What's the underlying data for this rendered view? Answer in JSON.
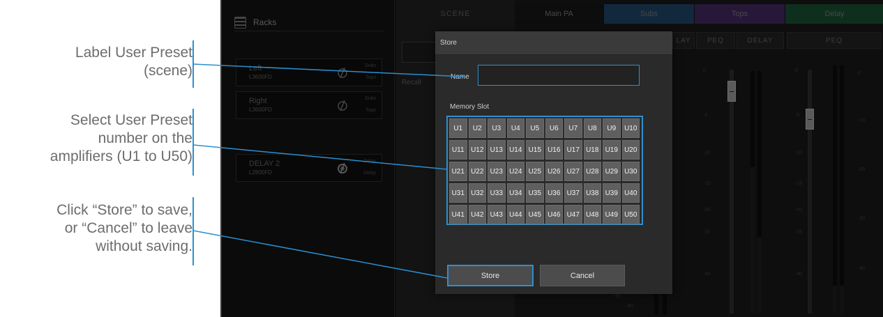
{
  "annotations": [
    {
      "lines": [
        "Label User Preset",
        "(scene)"
      ]
    },
    {
      "lines": [
        "Select User Preset",
        "number on the",
        "amplifiers (U1 to U50)"
      ]
    },
    {
      "lines": [
        "Click “Store” to save,",
        "or “Cancel” to leave",
        "without saving."
      ]
    }
  ],
  "colors": {
    "accent": "#2f8fcf",
    "subs": "#1d3f5e",
    "tops": "#3c2559",
    "delay": "#17492f",
    "main_pa": "#141414"
  },
  "racks": {
    "title": "Racks",
    "icon": "rack-list-icon",
    "items": [
      {
        "name": "Left",
        "model": "L3600FD",
        "groups": [
          "Subs",
          "Tops"
        ]
      },
      {
        "name": "Right",
        "model": "L3600FD",
        "groups": [
          "Subs",
          "Tops"
        ]
      },
      {
        "name": "DELAY 2",
        "model": "L2800FD",
        "groups": [
          "Delay",
          "Delay"
        ]
      }
    ]
  },
  "scene": {
    "title": "SCENE",
    "recall": "Recall"
  },
  "groups": {
    "headers": [
      "Main PA",
      "Subs",
      "Tops",
      "Delay"
    ],
    "tabs": [
      "LAY",
      "PEQ",
      "DELAY",
      "PEQ"
    ],
    "scale_labels": [
      "0",
      "-5",
      "-10",
      "-15",
      "-20",
      "-25",
      "-30",
      "-40",
      "-50",
      "-60"
    ]
  },
  "dialog": {
    "title": "Store",
    "name_label": "Name",
    "name_value": "",
    "memory_label": "Memory Slot",
    "slots": [
      "U1",
      "U2",
      "U3",
      "U4",
      "U5",
      "U6",
      "U7",
      "U8",
      "U9",
      "U10",
      "U11",
      "U12",
      "U13",
      "U14",
      "U15",
      "U16",
      "U17",
      "U18",
      "U19",
      "U20",
      "U21",
      "U22",
      "U23",
      "U24",
      "U25",
      "U26",
      "U27",
      "U28",
      "U29",
      "U30",
      "U31",
      "U32",
      "U33",
      "U34",
      "U35",
      "U36",
      "U37",
      "U38",
      "U39",
      "U40",
      "U41",
      "U42",
      "U43",
      "U44",
      "U45",
      "U46",
      "U47",
      "U48",
      "U49",
      "U50"
    ],
    "store_label": "Store",
    "cancel_label": "Cancel"
  }
}
